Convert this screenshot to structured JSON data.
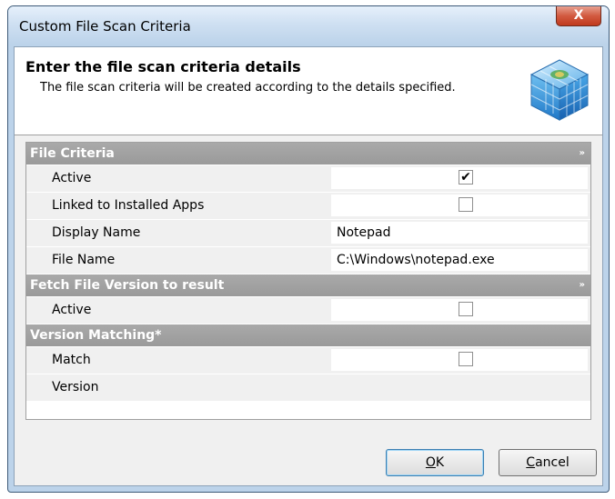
{
  "window": {
    "title": "Custom File Scan Criteria",
    "close_label": "X"
  },
  "header": {
    "title": "Enter the file scan criteria details",
    "subtitle": "The file scan criteria will be created according to the details specified.",
    "icon": "cube-icon"
  },
  "categories": [
    {
      "label": "File Criteria",
      "toggle": "»"
    },
    {
      "label": "Fetch File Version to result",
      "toggle": "»"
    },
    {
      "label": "Version Matching*"
    }
  ],
  "rows": {
    "file_active": {
      "label": "Active",
      "checked": true
    },
    "linked": {
      "label": "Linked to Installed Apps",
      "checked": false
    },
    "display_name": {
      "label": "Display Name",
      "value": "Notepad"
    },
    "file_name": {
      "label": "File Name",
      "value": "C:\\Windows\\notepad.exe"
    },
    "fetch_active": {
      "label": "Active",
      "checked": false
    },
    "match": {
      "label": "Match",
      "checked": false
    },
    "version": {
      "label": "Version",
      "value": ""
    }
  },
  "buttons": {
    "ok": {
      "accel": "O",
      "rest": "K"
    },
    "cancel": {
      "accel": "C",
      "rest": "ancel"
    }
  }
}
